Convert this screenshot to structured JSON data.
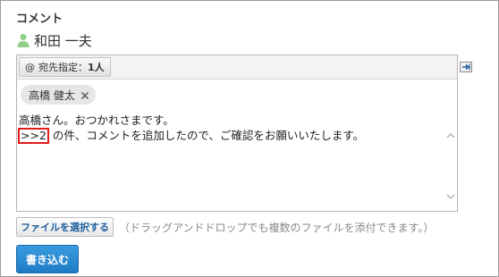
{
  "section": {
    "title": "コメント"
  },
  "user": {
    "name": "和田 一夫",
    "icon": "user-icon",
    "icon_color": "#8fcf8a"
  },
  "editor": {
    "address_button": {
      "at": "@",
      "label": "宛先指定：",
      "count": "1人"
    },
    "recipients": [
      {
        "name": "高橋 健太"
      }
    ],
    "text_line1": "高橋さん。おつかれさまです。",
    "quote_ref": ">>2",
    "text_line2_rest": " の件、コメントを追加したので、ご確認をお願いいたします。"
  },
  "attachments": {
    "button_label": "ファイルを選択する",
    "note": "（ドラッグアンドドロップでも複数のファイルを添付できます。）"
  },
  "submit": {
    "label": "書き込む"
  },
  "colors": {
    "accent": "#1f7cc4",
    "highlight": "#e11a1a"
  }
}
